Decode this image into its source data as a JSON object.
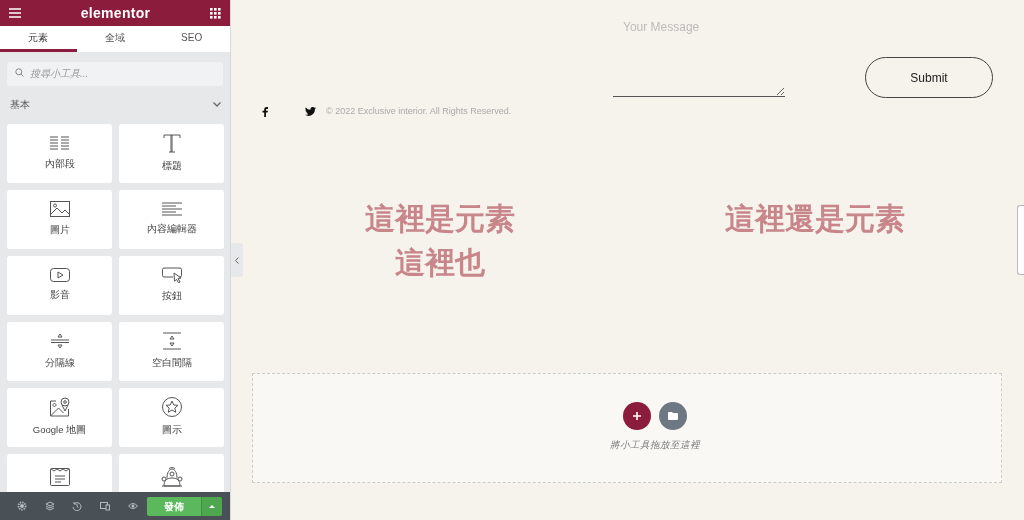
{
  "panel": {
    "logo": "elementor",
    "tabs": [
      {
        "label": "元素",
        "selected": true
      },
      {
        "label": "全域",
        "selected": false
      },
      {
        "label": "SEO",
        "selected": false
      }
    ],
    "search": {
      "placeholder": "搜尋小工具..."
    },
    "section": {
      "title": "基本",
      "expanded": true
    },
    "widgets": [
      {
        "kind": "inner-section",
        "label": "內部段"
      },
      {
        "kind": "heading",
        "label": "標題"
      },
      {
        "kind": "image",
        "label": "圖片"
      },
      {
        "kind": "text-editor",
        "label": "內容編輯器"
      },
      {
        "kind": "video",
        "label": "影音"
      },
      {
        "kind": "button",
        "label": "按鈕"
      },
      {
        "kind": "divider",
        "label": "分隔線"
      },
      {
        "kind": "spacer",
        "label": "空白間隔"
      },
      {
        "kind": "map",
        "label": "Google 地圖"
      },
      {
        "kind": "icon",
        "label": "圖示"
      },
      {
        "kind": "form"
      },
      {
        "kind": "mascot"
      }
    ],
    "publish": "發佈"
  },
  "canvas": {
    "form": {
      "message_placeholder": "Your Message",
      "submit": "Submit"
    },
    "footer": {
      "copyright": "© 2022 Exclusive interior. All Rights Reserved."
    },
    "columns": [
      {
        "headings": [
          "這裡是元素",
          "這裡也"
        ]
      },
      {
        "headings": [
          "這裡還是元素"
        ]
      }
    ],
    "dropzone": {
      "hint": "將小工具拖放至這裡"
    }
  }
}
